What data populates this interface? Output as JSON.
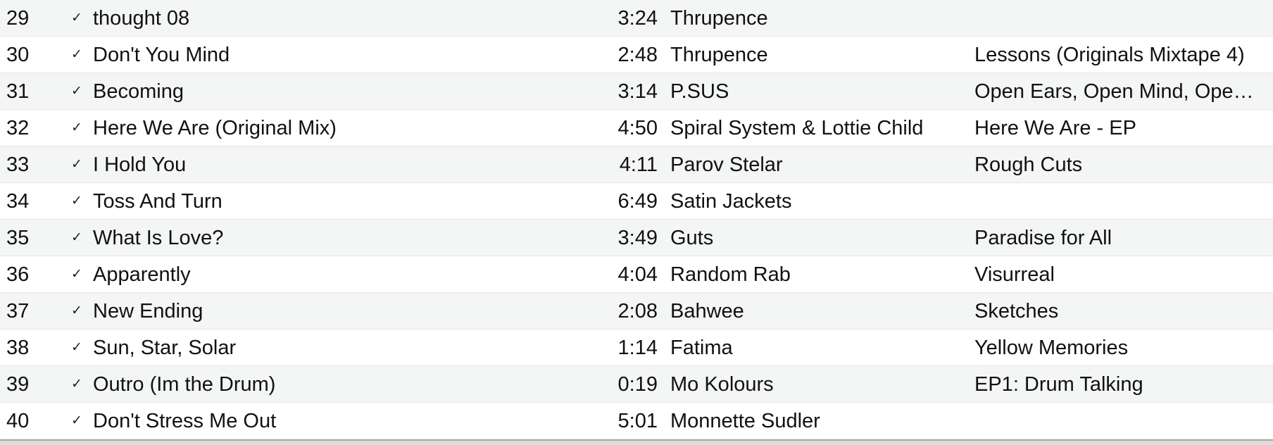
{
  "tracks": [
    {
      "num": "29",
      "title": "thought 08",
      "time": "3:24",
      "artist": "Thrupence",
      "album": ""
    },
    {
      "num": "30",
      "title": "Don't You Mind",
      "time": "2:48",
      "artist": "Thrupence",
      "album": "Lessons (Originals Mixtape 4)"
    },
    {
      "num": "31",
      "title": "Becoming",
      "time": "3:14",
      "artist": "P.SUS",
      "album": "Open Ears, Open Mind, Ope…"
    },
    {
      "num": "32",
      "title": "Here We Are (Original Mix)",
      "time": "4:50",
      "artist": "Spiral System & Lottie Child",
      "album": "Here We Are - EP"
    },
    {
      "num": "33",
      "title": "I Hold You",
      "time": "4:11",
      "artist": "Parov Stelar",
      "album": "Rough Cuts"
    },
    {
      "num": "34",
      "title": "Toss And Turn",
      "time": "6:49",
      "artist": "Satin Jackets",
      "album": ""
    },
    {
      "num": "35",
      "title": "What Is Love?",
      "time": "3:49",
      "artist": "Guts",
      "album": "Paradise for All"
    },
    {
      "num": "36",
      "title": "Apparently",
      "time": "4:04",
      "artist": "Random Rab",
      "album": "Visurreal"
    },
    {
      "num": "37",
      "title": "New Ending",
      "time": "2:08",
      "artist": "Bahwee",
      "album": "Sketches"
    },
    {
      "num": "38",
      "title": "Sun, Star, Solar",
      "time": "1:14",
      "artist": "Fatima",
      "album": "Yellow Memories"
    },
    {
      "num": "39",
      "title": "Outro (Im the Drum)",
      "time": "0:19",
      "artist": "Mo Kolours",
      "album": "EP1: Drum Talking"
    },
    {
      "num": "40",
      "title": "Don't Stress Me Out",
      "time": "5:01",
      "artist": "Monnette Sudler",
      "album": ""
    }
  ],
  "check_glyph": "✓",
  "colors": {
    "row_stripe": "#f4f5f5",
    "row_plain": "#ffffff",
    "text": "#111111"
  }
}
